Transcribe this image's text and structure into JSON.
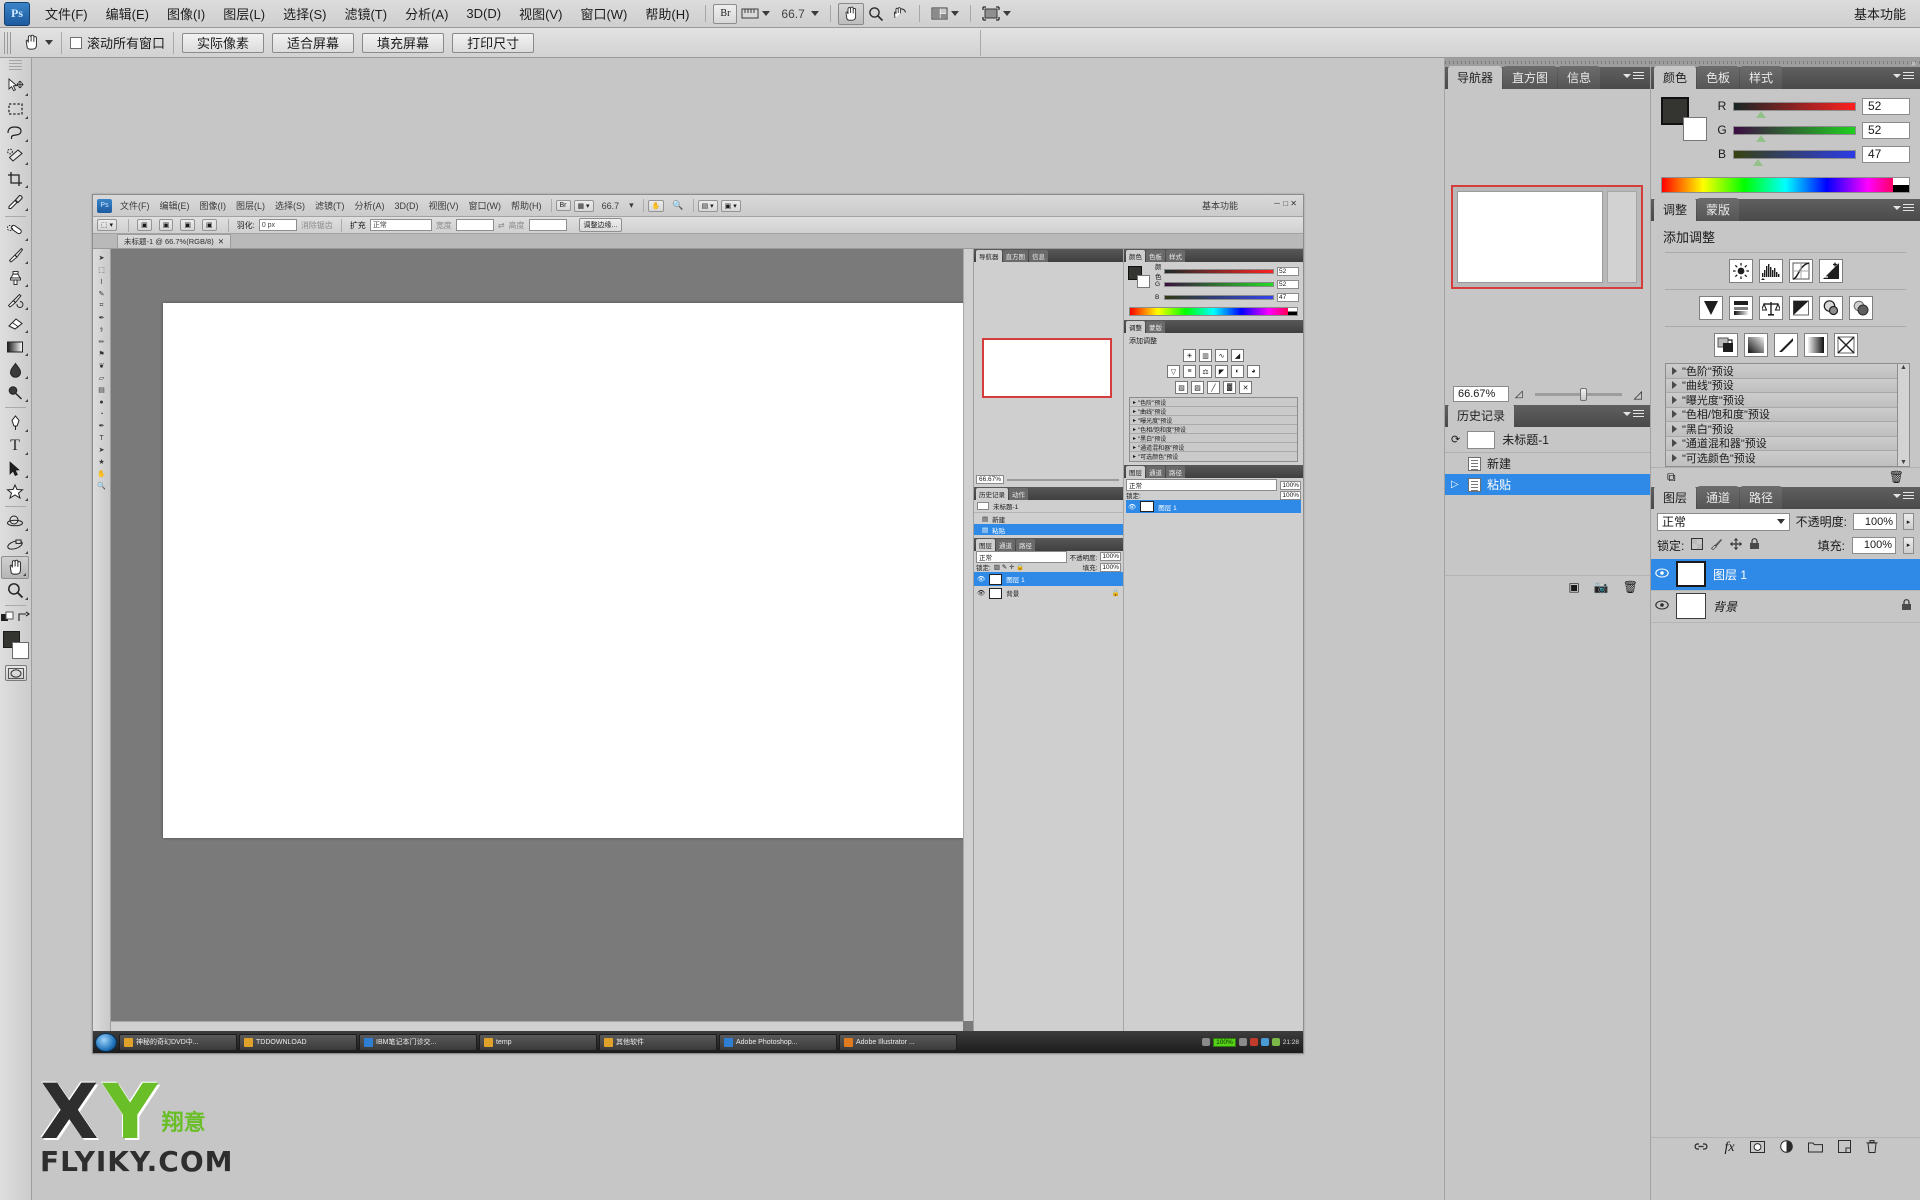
{
  "app": {
    "name": "Adobe Photoshop CS5",
    "logo_text": "Ps",
    "workspace": "基本功能",
    "zoom": "66.7",
    "accent_blue": "#2e8ae6",
    "panel_bg": "#c6c6c6"
  },
  "menubar": {
    "items": [
      {
        "label": "文件(F)"
      },
      {
        "label": "编辑(E)"
      },
      {
        "label": "图像(I)"
      },
      {
        "label": "图层(L)"
      },
      {
        "label": "选择(S)"
      },
      {
        "label": "滤镜(T)"
      },
      {
        "label": "分析(A)"
      },
      {
        "label": "3D(D)"
      },
      {
        "label": "视图(V)"
      },
      {
        "label": "窗口(W)"
      },
      {
        "label": "帮助(H)"
      }
    ],
    "bridge_label": "Br",
    "view_extras_icon": "ruler-icon",
    "zoom_value": "66.7",
    "hand_tool_icon": "hand-icon",
    "zoom_tool_icon": "magnifier-icon",
    "rotate_tool_icon": "rotate-view-icon",
    "arrange_icon": "arrange-documents-icon",
    "screenmode_icon": "screen-mode-icon",
    "workspace_label": "基本功能"
  },
  "optionsbar": {
    "tool_icon": "hand-icon",
    "scroll_all_label": "滚动所有窗口",
    "buttons": [
      {
        "label": "实际像素"
      },
      {
        "label": "适合屏幕"
      },
      {
        "label": "填充屏幕"
      },
      {
        "label": "打印尺寸"
      }
    ]
  },
  "toolbox": {
    "tools": [
      {
        "name": "move-tool",
        "glyph": "➤"
      },
      {
        "name": "marquee-tool",
        "glyph": "⬚"
      },
      {
        "name": "lasso-tool",
        "glyph": "➿"
      },
      {
        "name": "quick-selection-tool",
        "glyph": "✎"
      },
      {
        "name": "crop-tool",
        "glyph": "⌗"
      },
      {
        "name": "eyedropper-tool",
        "glyph": "✐"
      },
      {
        "name": "healing-brush-tool",
        "glyph": "⚗"
      },
      {
        "name": "brush-tool",
        "glyph": "✒"
      },
      {
        "name": "clone-stamp-tool",
        "glyph": "⚑"
      },
      {
        "name": "history-brush-tool",
        "glyph": "❦"
      },
      {
        "name": "eraser-tool",
        "glyph": "▱"
      },
      {
        "name": "gradient-tool",
        "glyph": "▤"
      },
      {
        "name": "blur-tool",
        "glyph": "●"
      },
      {
        "name": "dodge-tool",
        "glyph": "⚲"
      },
      {
        "name": "pen-tool",
        "glyph": "✒"
      },
      {
        "name": "type-tool",
        "glyph": "T"
      },
      {
        "name": "path-selection-tool",
        "glyph": "➤"
      },
      {
        "name": "shape-tool",
        "glyph": "⭐"
      },
      {
        "name": "3d-object-rotate-tool",
        "glyph": "◔"
      },
      {
        "name": "3d-camera-rotate-tool",
        "glyph": "◑"
      },
      {
        "name": "hand-tool",
        "glyph": "✋",
        "active": true
      },
      {
        "name": "zoom-tool",
        "glyph": "⚲"
      }
    ],
    "foreground_color": "#343431",
    "background_color": "#ffffff",
    "quickmask_icon": "quick-mask-icon"
  },
  "nested_window": {
    "title_mode": "基本功能",
    "menu_items": [
      "文件(F)",
      "编辑(E)",
      "图像(I)",
      "图层(L)",
      "选择(S)",
      "滤镜(T)",
      "分析(A)",
      "3D(D)",
      "视图(V)",
      "窗口(W)",
      "帮助(H)"
    ],
    "bridge_label": "Br",
    "zoom_value": "66.7",
    "document_tab": "未标题-1 @ 66.7%(RGB/8)",
    "options": {
      "feather_label": "羽化:",
      "feather_value": "0 px",
      "antialias_label": "消除锯齿",
      "refine_label": "调整边缘...",
      "mode_label": "正常",
      "expand_label": "扩充",
      "width_label": "宽度",
      "height_label": "高度"
    },
    "color_panel": {
      "tabs": [
        "颜色",
        "色板",
        "样式"
      ],
      "r": "52",
      "g": "52",
      "b": "47"
    },
    "adjustments_panel": {
      "tabs": [
        "调整",
        "蒙版"
      ],
      "title": "添加调整",
      "presets": [
        "\"色阶\"预设",
        "\"曲线\"预设",
        "\"曝光度\"预设",
        "\"色相/饱和度\"预设",
        "\"黑白\"预设",
        "\"通道混和器\"预设",
        "\"可选颜色\"预设"
      ]
    },
    "navigator_panel": {
      "tabs": [
        "导航器",
        "直方图",
        "信息"
      ],
      "zoom": "66.67%"
    },
    "history_panel": {
      "tabs": [
        "历史记录",
        "动作"
      ],
      "snapshot": "未标题-1",
      "items": [
        {
          "label": "新建",
          "selected": false
        },
        {
          "label": "粘贴",
          "selected": true
        }
      ]
    },
    "layers_panel": {
      "tabs": [
        "图层",
        "通道",
        "路径"
      ],
      "blend_mode": "正常",
      "opacity_label": "不透明度:",
      "opacity": "100%",
      "lock_label": "锁定:",
      "fill_label": "填充:",
      "fill": "100%",
      "layers": [
        {
          "name": "图层 1",
          "selected": true,
          "locked": false
        },
        {
          "name": "背景",
          "selected": false,
          "locked": true
        }
      ]
    },
    "taskbar": {
      "start_icon": "windows-start-icon",
      "items": [
        {
          "label": "神秘的奇幻DVD中...",
          "icon": "folder-icon"
        },
        {
          "label": "TDDOWNLOAD",
          "icon": "folder-icon"
        },
        {
          "label": "IBM笔记本门诊交...",
          "icon": "ie-icon"
        },
        {
          "label": "temp",
          "icon": "folder-icon"
        },
        {
          "label": "其他软件",
          "icon": "folder-icon"
        },
        {
          "label": "Adobe Photoshop...",
          "icon": "photoshop-icon"
        },
        {
          "label": "Adobe Illustrator ...",
          "icon": "illustrator-icon"
        }
      ],
      "battery": "100%",
      "clock": "21:28"
    }
  },
  "navigator_panel": {
    "tabs": [
      "导航器",
      "直方图",
      "信息"
    ],
    "zoom": "66.67%"
  },
  "color_panel": {
    "tabs": [
      "颜色",
      "色板",
      "样式"
    ],
    "channels": [
      {
        "label": "R",
        "value": "52",
        "pos": 20
      },
      {
        "label": "G",
        "value": "52",
        "pos": 20
      },
      {
        "label": "B",
        "value": "47",
        "pos": 18
      }
    ],
    "foreground_color": "#343431",
    "background_color": "#ffffff"
  },
  "adjustments_panel": {
    "tabs": [
      "调整",
      "蒙版"
    ],
    "title": "添加调整",
    "row1": [
      {
        "name": "brightness-contrast-icon",
        "glyph": "☀"
      },
      {
        "name": "levels-icon",
        "glyph": "ᵛ"
      },
      {
        "name": "curves-icon",
        "glyph": "∿"
      },
      {
        "name": "exposure-icon",
        "glyph": "◢"
      }
    ],
    "row2": [
      {
        "name": "vibrance-icon",
        "glyph": "▽"
      },
      {
        "name": "hue-saturation-icon",
        "glyph": "≡"
      },
      {
        "name": "color-balance-icon",
        "glyph": "⚖"
      },
      {
        "name": "black-white-icon",
        "glyph": "◤"
      },
      {
        "name": "photo-filter-icon",
        "glyph": "◐"
      },
      {
        "name": "channel-mixer-icon",
        "glyph": "◕"
      }
    ],
    "row3": [
      {
        "name": "invert-icon",
        "glyph": "◧"
      },
      {
        "name": "posterize-icon",
        "glyph": "◨"
      },
      {
        "name": "threshold-icon",
        "glyph": "╱"
      },
      {
        "name": "gradient-map-icon",
        "glyph": "▓"
      },
      {
        "name": "selective-color-icon",
        "glyph": "✕"
      }
    ],
    "presets": [
      "\"色阶\"预设",
      "\"曲线\"预设",
      "\"曝光度\"预设",
      "\"色相/饱和度\"预设",
      "\"黑白\"预设",
      "\"通道混和器\"预设",
      "\"可选颜色\"预设"
    ],
    "footer": {
      "return_icon": "return-to-adjustment-list-icon",
      "delete_icon": "delete-adjustment-icon"
    }
  },
  "history_panel": {
    "tabs": [
      "历史记录"
    ],
    "snapshot_label": "未标题-1",
    "items": [
      {
        "label": "新建",
        "selected": false
      },
      {
        "label": "粘贴",
        "selected": true
      }
    ],
    "footer_icons": [
      "new-document-from-state-icon",
      "new-snapshot-icon",
      "delete-state-icon"
    ]
  },
  "layers_panel": {
    "tabs": [
      "图层",
      "通道",
      "路径"
    ],
    "blend_mode": "正常",
    "opacity_label": "不透明度:",
    "opacity_value": "100%",
    "lock_label": "锁定:",
    "lock_icons": [
      "lock-transparent-pixels-icon",
      "lock-image-pixels-icon",
      "lock-position-icon",
      "lock-all-icon"
    ],
    "fill_label": "填充:",
    "fill_value": "100%",
    "layers": [
      {
        "name": "图层 1",
        "selected": true,
        "locked": false
      },
      {
        "name": "背景",
        "selected": false,
        "locked": true
      }
    ],
    "footer_icons": [
      "link-layers-icon",
      "layer-style-icon",
      "layer-mask-icon",
      "new-fill-adjustment-icon",
      "new-group-icon",
      "new-layer-icon",
      "delete-layer-icon"
    ]
  },
  "watermark": {
    "letter_x": "X",
    "letter_y": "Y",
    "cn": "翔意",
    "url": "FLYIKY.COM",
    "green": "#6abf28"
  }
}
